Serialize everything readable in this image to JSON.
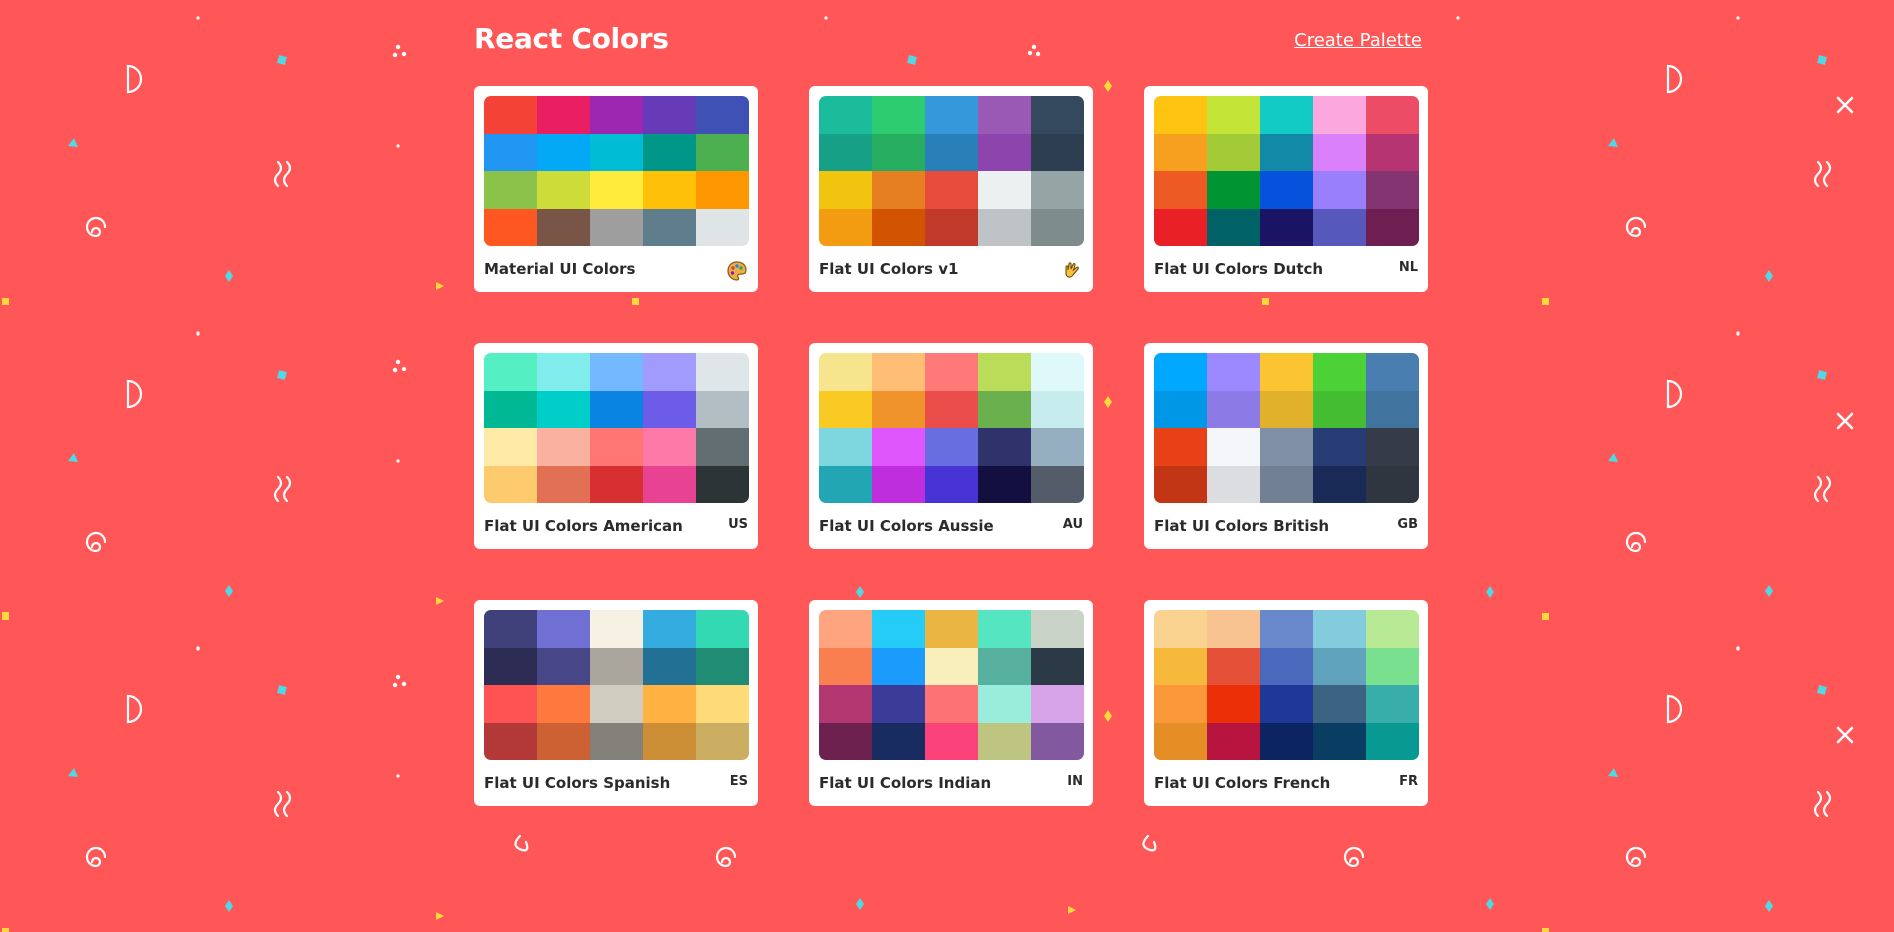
{
  "colors": {
    "background": "#ff5757",
    "card": "#ffffff"
  },
  "header": {
    "title": "React Colors",
    "create_label": "Create Palette"
  },
  "palettes": [
    {
      "name": "Material UI Colors",
      "emoji": "palette-icon",
      "colors": [
        "#f44336",
        "#e91e63",
        "#9c27b0",
        "#673ab7",
        "#3f51b5",
        "#2196f3",
        "#03a9f4",
        "#00bcd4",
        "#009688",
        "#4caf50",
        "#8bc34a",
        "#cddc39",
        "#ffeb3b",
        "#ffc107",
        "#ff9800",
        "#ff5722",
        "#795548",
        "#9e9e9e",
        "#607d8b",
        "#dfe4e6"
      ]
    },
    {
      "name": "Flat UI Colors v1",
      "emoji": "hand-wave-icon",
      "colors": [
        "#1abc9c",
        "#2ecc71",
        "#3498db",
        "#9b59b6",
        "#34495e",
        "#16a085",
        "#27ae60",
        "#2980b9",
        "#8e44ad",
        "#2c3e50",
        "#f1c40f",
        "#e67e22",
        "#e74c3c",
        "#ecf0f1",
        "#95a5a6",
        "#f39c12",
        "#d35400",
        "#c0392b",
        "#bdc3c7",
        "#7f8c8d"
      ]
    },
    {
      "name": "Flat UI Colors Dutch",
      "emoji": "NL",
      "colors": [
        "#ffc312",
        "#c4e538",
        "#12cbc4",
        "#fda7df",
        "#ed4c67",
        "#f79f1f",
        "#a3cb38",
        "#1289a7",
        "#d980fa",
        "#b53471",
        "#ee5a24",
        "#009432",
        "#0652dd",
        "#9980fa",
        "#833471",
        "#ea2027",
        "#006266",
        "#1b1464",
        "#5758bb",
        "#6f1e51"
      ]
    },
    {
      "name": "Flat UI Colors American",
      "emoji": "US",
      "colors": [
        "#55efc4",
        "#81ecec",
        "#74b9ff",
        "#a29bfe",
        "#dfe6e9",
        "#00b894",
        "#00cec9",
        "#0984e3",
        "#6c5ce7",
        "#b2bec3",
        "#ffeaa7",
        "#fab1a0",
        "#ff7675",
        "#fd79a8",
        "#636e72",
        "#fdcb6e",
        "#e17055",
        "#d63031",
        "#e84393",
        "#2d3436"
      ]
    },
    {
      "name": "Flat UI Colors Aussie",
      "emoji": "AU",
      "colors": [
        "#f6e58d",
        "#ffbe76",
        "#ff7979",
        "#badc58",
        "#dff9fb",
        "#f9ca24",
        "#f0932b",
        "#eb4d4b",
        "#6ab04c",
        "#c7ecee",
        "#7ed6df",
        "#e056fd",
        "#686de0",
        "#30336b",
        "#95afc0",
        "#22a6b3",
        "#be2edd",
        "#4834d4",
        "#130f40",
        "#535c68"
      ]
    },
    {
      "name": "Flat UI Colors British",
      "emoji": "GB",
      "colors": [
        "#00a8ff",
        "#9c88ff",
        "#fbc531",
        "#4cd137",
        "#487eb0",
        "#0097e6",
        "#8c7ae6",
        "#e1b12c",
        "#44bd32",
        "#40739e",
        "#e84118",
        "#f5f6fa",
        "#7f8fa6",
        "#273c75",
        "#353b48",
        "#c23616",
        "#dcdde1",
        "#718093",
        "#192a56",
        "#2f3640"
      ]
    },
    {
      "name": "Flat UI Colors Spanish",
      "emoji": "ES",
      "colors": [
        "#40407a",
        "#706fd3",
        "#f7f1e3",
        "#34ace0",
        "#33d9b2",
        "#2c2c54",
        "#474787",
        "#aaa69d",
        "#227093",
        "#218c74",
        "#ff5252",
        "#ff793f",
        "#d1ccc0",
        "#ffb142",
        "#ffda79",
        "#b33939",
        "#cd6133",
        "#84817a",
        "#cc8e35",
        "#ccae62"
      ]
    },
    {
      "name": "Flat UI Colors Indian",
      "emoji": "IN",
      "colors": [
        "#fea47f",
        "#25ccf7",
        "#eab543",
        "#55e6c1",
        "#cad3c8",
        "#f97f51",
        "#1b9cfc",
        "#f8efba",
        "#58b19f",
        "#2c3a47",
        "#b33771",
        "#3b3b98",
        "#fd7272",
        "#9aecdb",
        "#d6a2e8",
        "#6d214f",
        "#182c61",
        "#fc427b",
        "#bdc581",
        "#82589f"
      ]
    },
    {
      "name": "Flat UI Colors French",
      "emoji": "FR",
      "colors": [
        "#fad390",
        "#f8c291",
        "#6a89cc",
        "#82ccdd",
        "#b8e994",
        "#f6b93b",
        "#e55039",
        "#4a69bd",
        "#60a3bc",
        "#78e08f",
        "#fa983a",
        "#eb2f06",
        "#1e3799",
        "#3c6382",
        "#38ada9",
        "#e58e26",
        "#b71540",
        "#0c2461",
        "#0a3d62",
        "#079992"
      ]
    }
  ]
}
